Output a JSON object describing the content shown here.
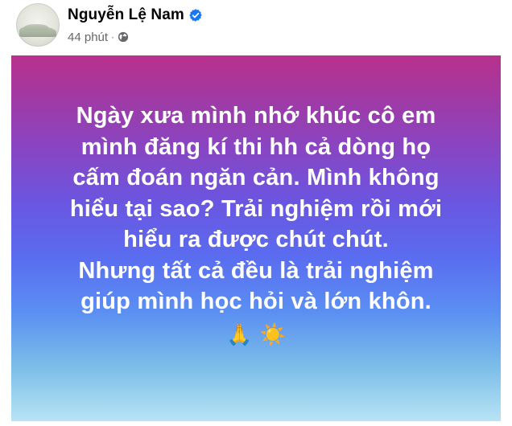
{
  "post": {
    "author_name": "Nguyễn Lệ Nam",
    "timestamp": "44 phút",
    "separator": "·",
    "privacy_icon": "globe-icon",
    "verified_icon": "verified-badge-icon",
    "status_lines": [
      "Ngày xưa mình nhớ khúc cô em",
      "mình đăng kí thi hh cả dòng họ",
      "cấm đoán ngăn cản. Mình không",
      "hiểu tại sao?  Trải nghiệm rồi mới",
      "hiểu ra được chút chút.",
      "Nhưng tất cả đều là trải nghiệm",
      "giúp mình học hỏi và lớn khôn."
    ],
    "emojis": [
      "🙏",
      "☀️"
    ]
  },
  "colors": {
    "gradient_top": "#b8318c",
    "gradient_mid": "#6b55e0",
    "gradient_bottom": "#b8e4f4",
    "verified_blue": "#1877f2",
    "meta_gray": "#65676b"
  }
}
